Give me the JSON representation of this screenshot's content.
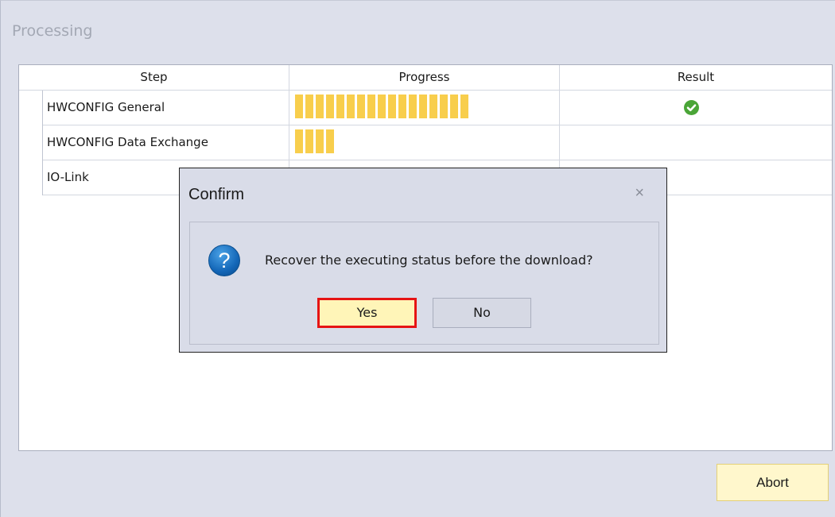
{
  "window": {
    "title": "Processing"
  },
  "grid": {
    "columns": [
      "Step",
      "Progress",
      "Result"
    ],
    "rows": [
      {
        "step": "HWCONFIG General",
        "progress_segments": 17,
        "progress_fraction": 1.0,
        "result": "success-check-icon"
      },
      {
        "step": "HWCONFIG Data Exchange",
        "progress_segments": 4,
        "progress_fraction": 0.24,
        "result": ""
      },
      {
        "step": "IO-Link",
        "progress_segments": 0,
        "progress_fraction": 0,
        "result": ""
      }
    ]
  },
  "abort_label": "Abort",
  "dialog": {
    "title": "Confirm",
    "close_glyph": "×",
    "icon": "question-icon",
    "icon_glyph": "?",
    "message": "Recover the executing status before the download?",
    "yes_label": "Yes",
    "no_label": "No"
  },
  "colors": {
    "progress": "#f8ce4c",
    "success": "#4aa537",
    "highlight_border": "#e61414",
    "button_bg": "#fff5b8"
  }
}
